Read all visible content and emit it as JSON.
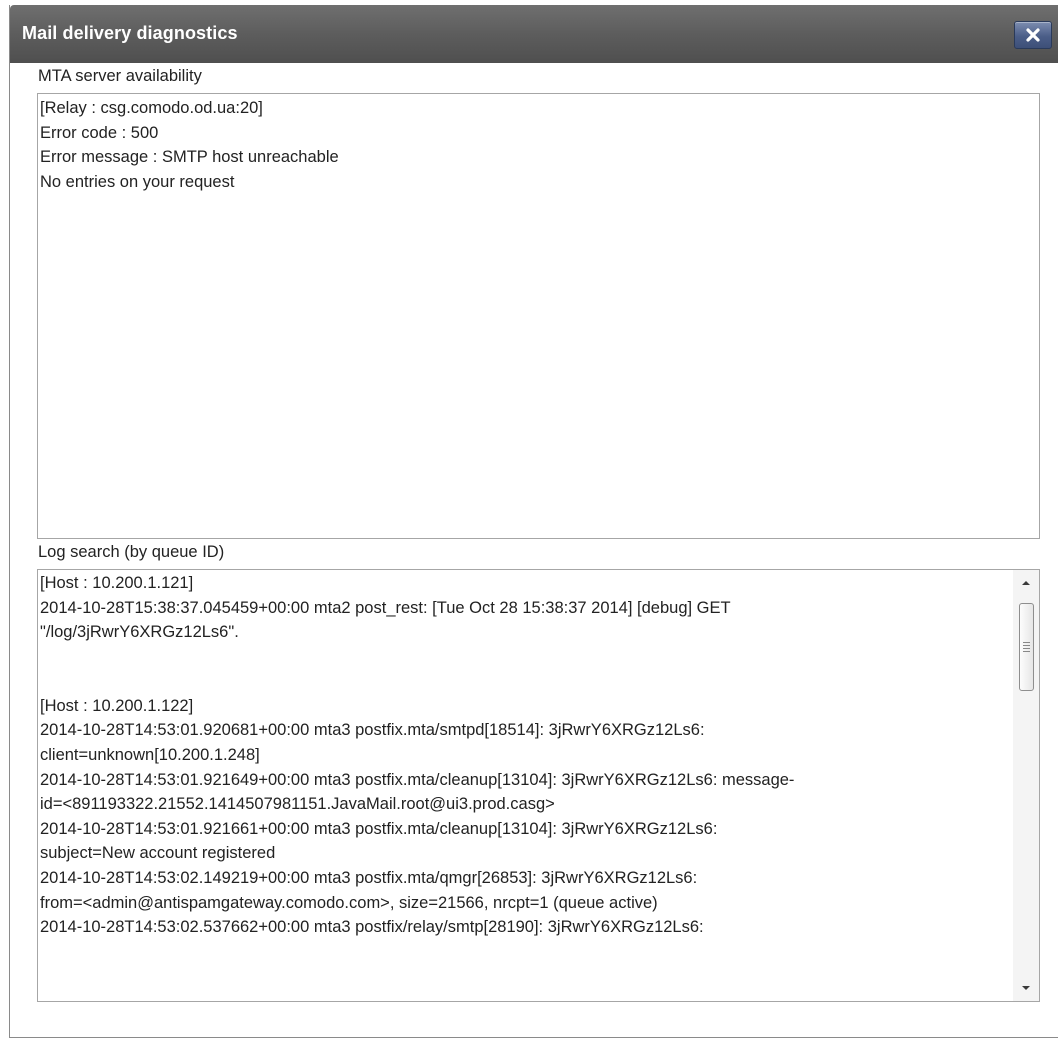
{
  "dialog": {
    "title": "Mail delivery diagnostics",
    "close_icon": "close-icon"
  },
  "mta": {
    "label": "MTA server availability",
    "lines": [
      "[Relay : csg.comodo.od.ua:20]",
      "Error code : 500",
      "Error message : SMTP host unreachable",
      "No entries on your request"
    ]
  },
  "log": {
    "label": "Log search (by queue ID)",
    "host1": {
      "header": "[Host : 10.200.1.121]",
      "lines": [
        "2014-10-28T15:38:37.045459+00:00 mta2 post_rest: [Tue Oct 28 15:38:37 2014] [debug] GET",
        "\"/log/3jRwrY6XRGz12Ls6\"."
      ]
    },
    "host2": {
      "header": "[Host : 10.200.1.122]",
      "lines": [
        "2014-10-28T14:53:01.920681+00:00 mta3 postfix.mta/smtpd[18514]: 3jRwrY6XRGz12Ls6:",
        "client=unknown[10.200.1.248]",
        "2014-10-28T14:53:01.921649+00:00 mta3 postfix.mta/cleanup[13104]: 3jRwrY6XRGz12Ls6: message-",
        "id=<891193322.21552.1414507981151.JavaMail.root@ui3.prod.casg>",
        "2014-10-28T14:53:01.921661+00:00 mta3 postfix.mta/cleanup[13104]: 3jRwrY6XRGz12Ls6:",
        "subject=New account registered",
        "2014-10-28T14:53:02.149219+00:00 mta3 postfix.mta/qmgr[26853]: 3jRwrY6XRGz12Ls6:",
        "from=<admin@antispamgateway.comodo.com>, size=21566, nrcpt=1 (queue active)",
        "2014-10-28T14:53:02.537662+00:00 mta3 postfix/relay/smtp[28190]: 3jRwrY6XRGz12Ls6:"
      ]
    },
    "scroll_up_icon": "scroll-up-arrow-icon",
    "scroll_down_icon": "scroll-down-arrow-icon"
  },
  "colors": {
    "titlebar": "#5d5d5d",
    "close_button": "#4b5e88",
    "panel_border": "#a6a6a6"
  }
}
